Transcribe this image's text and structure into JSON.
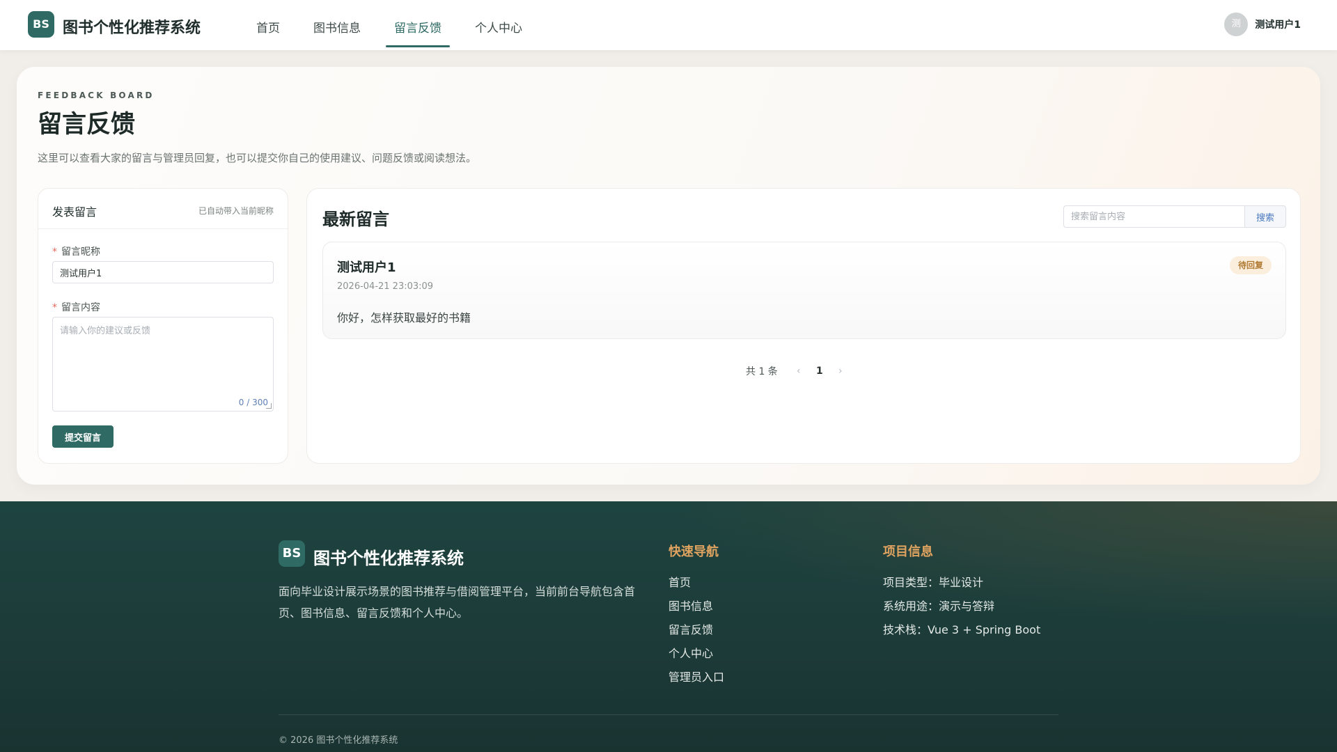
{
  "header": {
    "logo_text": "BS",
    "brand": "图书个性化推荐系统",
    "nav": [
      {
        "label": "首页",
        "active": false
      },
      {
        "label": "图书信息",
        "active": false
      },
      {
        "label": "留言反馈",
        "active": true
      },
      {
        "label": "个人中心",
        "active": false
      }
    ],
    "user": {
      "avatar_text": "测",
      "name": "测试用户1"
    }
  },
  "page": {
    "eyebrow": "FEEDBACK BOARD",
    "title": "留言反馈",
    "description": "这里可以查看大家的留言与管理员回复，也可以提交你自己的使用建议、问题反馈或阅读想法。"
  },
  "form": {
    "title": "发表留言",
    "note": "已自动带入当前昵称",
    "nickname_label": "留言昵称",
    "nickname_value": "测试用户1",
    "content_label": "留言内容",
    "content_placeholder": "请输入你的建议或反馈",
    "char_count": "0 / 300",
    "submit_label": "提交留言"
  },
  "list": {
    "title": "最新留言",
    "search_placeholder": "搜索留言内容",
    "search_button": "搜索",
    "messages": [
      {
        "user": "测试用户1",
        "time": "2026-04-21 23:03:09",
        "content": "你好，怎样获取最好的书籍",
        "status": "待回复"
      }
    ],
    "pagination": {
      "total_text": "共 1 条",
      "current_page": "1",
      "prev_icon": "‹",
      "next_icon": "›"
    }
  },
  "footer": {
    "logo_text": "BS",
    "brand": "图书个性化推荐系统",
    "description": "面向毕业设计展示场景的图书推荐与借阅管理平台，当前前台导航包含首页、图书信息、留言反馈和个人中心。",
    "quick_nav": {
      "title": "快速导航",
      "links": [
        "首页",
        "图书信息",
        "留言反馈",
        "个人中心",
        "管理员入口"
      ]
    },
    "project_info": {
      "title": "项目信息",
      "items": [
        "项目类型：毕业设计",
        "系统用途：演示与答辩",
        "技术栈：Vue 3 + Spring Boot"
      ]
    },
    "copyright": "© 2026 图书个性化推荐系统"
  },
  "colors": {
    "accent": "#2f6b64",
    "footer_bg": "#1e4440",
    "footer_heading": "#e0a460",
    "badge_bg": "#fbeedd",
    "badge_text": "#b07a32"
  }
}
